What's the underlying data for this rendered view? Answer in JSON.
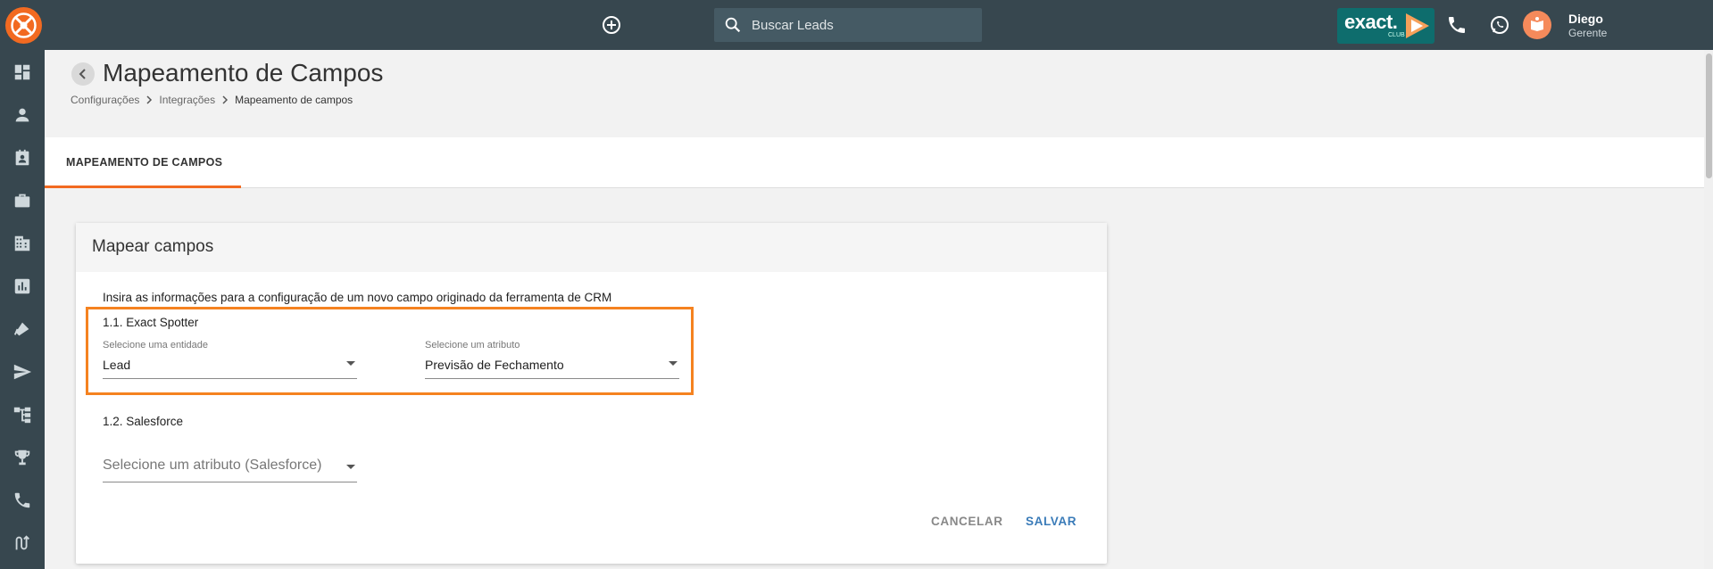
{
  "header": {
    "search_placeholder": "Buscar Leads",
    "brand_badge": {
      "word": "exact.",
      "sub": "CLUB"
    },
    "user": {
      "name": "Diego",
      "role": "Gerente"
    }
  },
  "sidebar": {
    "items": [
      "dashboard-icon",
      "person-icon",
      "contact-card-icon",
      "briefcase-icon",
      "building-icon",
      "chart-icon",
      "tag-icon",
      "send-icon",
      "hierarchy-icon",
      "trophy-icon",
      "phone-icon",
      "route-icon"
    ]
  },
  "page": {
    "title": "Mapeamento de Campos",
    "breadcrumb": [
      "Configurações",
      "Integrações",
      "Mapeamento de campos"
    ]
  },
  "tabs": [
    {
      "label": "MAPEAMENTO DE CAMPOS",
      "active": true
    }
  ],
  "card": {
    "title": "Mapear campos",
    "description": "Insira as informações para a configuração de um novo campo originado da ferramenta de CRM",
    "section1": {
      "label": "1.1. Exact Spotter",
      "entity": {
        "label": "Selecione uma entidade",
        "value": "Lead"
      },
      "attribute": {
        "label": "Selecione um atributo",
        "value": "Previsão de Fechamento"
      }
    },
    "section2": {
      "label": "1.2. Salesforce",
      "attribute_placeholder": "Selecione um atributo (Salesforce)"
    },
    "actions": {
      "cancel": "CANCELAR",
      "save": "SALVAR"
    }
  },
  "colors": {
    "topbar": "#37474f",
    "accent": "#f26a21",
    "highlight": "#f58220",
    "save": "#3a7bb8"
  }
}
